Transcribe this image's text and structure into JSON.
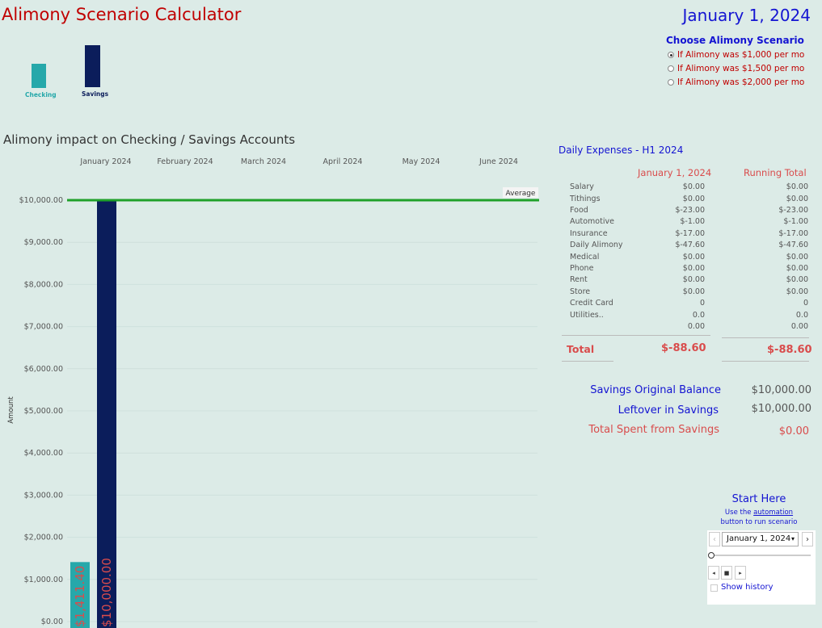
{
  "header": {
    "title": "Alimony Scenario Calculator",
    "date": "January 1, 2024"
  },
  "legend": {
    "items": [
      {
        "label": "Checking",
        "color": "#26a8aa"
      },
      {
        "label": "Savings",
        "color": "#0b1d5b"
      }
    ]
  },
  "scenario": {
    "heading": "Choose Alimony Scenario",
    "options": [
      {
        "label": "If Alimony was $1,000 per mo",
        "selected": true
      },
      {
        "label": "If Alimony was $1,500 per mo",
        "selected": false
      },
      {
        "label": "If Alimony was $2,000 per mo",
        "selected": false
      }
    ]
  },
  "chart_title": "Alimony impact on Checking / Savings Accounts",
  "chart_data": {
    "type": "bar",
    "categories": [
      "January 2024",
      "February 2024",
      "March 2024",
      "April 2024",
      "May 2024",
      "June 2024"
    ],
    "ylabel": "Amount",
    "ylim": [
      0,
      10300
    ],
    "yticks": [
      0,
      1000,
      2000,
      3000,
      4000,
      5000,
      6000,
      7000,
      8000,
      9000,
      10000
    ],
    "ytick_labels": [
      "$0.00",
      "$1,000.00",
      "$2,000.00",
      "$3,000.00",
      "$4,000.00",
      "$5,000.00",
      "$6,000.00",
      "$7,000.00",
      "$8,000.00",
      "$9,000.00",
      "$10,000.00"
    ],
    "series": [
      {
        "name": "Checking",
        "color": "#26a8aa",
        "values": [
          1411.4,
          null,
          null,
          null,
          null,
          null
        ],
        "labels": [
          "$1,411.40",
          "",
          "",
          "",
          "",
          ""
        ]
      },
      {
        "name": "Savings",
        "color": "#0b1d5b",
        "values": [
          10000,
          null,
          null,
          null,
          null,
          null
        ],
        "labels": [
          "$10,000.00",
          "",
          "",
          "",
          "",
          ""
        ]
      }
    ],
    "reference_line": {
      "label": "Average",
      "value": 10000,
      "color": "#1fa02a"
    },
    "grid": true
  },
  "expenses": {
    "heading": "Daily Expenses - H1 2024",
    "col_date": "January 1, 2024",
    "col_running": "Running Total",
    "rows": [
      {
        "name": "Salary",
        "daily": "$0.00",
        "running": "$0.00"
      },
      {
        "name": "Tithings",
        "daily": "$0.00",
        "running": "$0.00"
      },
      {
        "name": "Food",
        "daily": "$-23.00",
        "running": "$-23.00"
      },
      {
        "name": "Automotive",
        "daily": "$-1.00",
        "running": "$-1.00"
      },
      {
        "name": "Insurance",
        "daily": "$-17.00",
        "running": "$-17.00"
      },
      {
        "name": "Daily Alimony",
        "daily": "$-47.60",
        "running": "$-47.60"
      },
      {
        "name": "Medical",
        "daily": "$0.00",
        "running": "$0.00"
      },
      {
        "name": "Phone",
        "daily": "$0.00",
        "running": "$0.00"
      },
      {
        "name": "Rent",
        "daily": "$0.00",
        "running": "$0.00"
      },
      {
        "name": "Store",
        "daily": "$0.00",
        "running": "$0.00"
      },
      {
        "name": "Credit Card",
        "daily": "0",
        "running": "0"
      },
      {
        "name": "Utilities..",
        "daily": "0.0",
        "running": "0.0"
      },
      {
        "name": "",
        "daily": "0.00",
        "running": "0.00"
      }
    ],
    "total_label": "Total",
    "total_daily": "$-88.60",
    "total_running": "$-88.60"
  },
  "summary": {
    "original_label": "Savings Original Balance",
    "original_value": "$10,000.00",
    "leftover_label": "Leftover in Savings",
    "leftover_value": "$10,000.00",
    "spent_label": "Total Spent from Savings",
    "spent_value": "$0.00"
  },
  "start": {
    "heading": "Start Here",
    "sub_prefix": "Use the ",
    "sub_link": "automation",
    "sub_line2": "button to run scenario",
    "selected_date": "January 1, 2024",
    "show_history": "Show history",
    "icons": {
      "prev": "‹",
      "next": "›",
      "caret": "▾",
      "step_back": "◂",
      "stop": "■",
      "play": "▸"
    }
  },
  "colors": {
    "title_red": "#c00000",
    "blue": "#1414d2",
    "table_red": "#d94c4c",
    "background": "#dcebe7"
  }
}
